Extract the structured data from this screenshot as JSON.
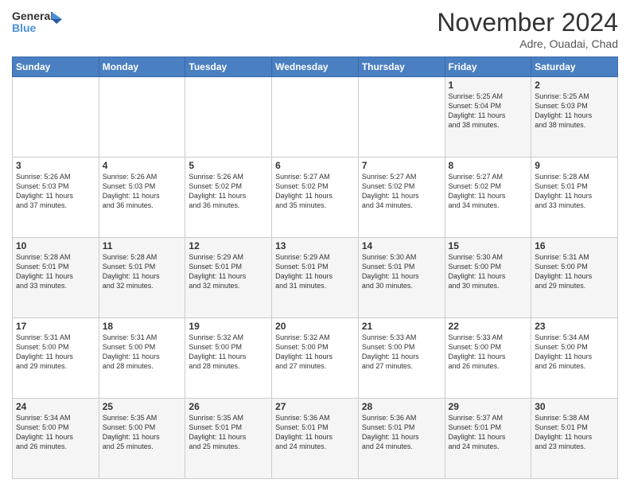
{
  "header": {
    "logo_line1": "General",
    "logo_line2": "Blue",
    "month": "November 2024",
    "location": "Adre, Ouadai, Chad"
  },
  "weekdays": [
    "Sunday",
    "Monday",
    "Tuesday",
    "Wednesday",
    "Thursday",
    "Friday",
    "Saturday"
  ],
  "weeks": [
    [
      {
        "day": "",
        "info": ""
      },
      {
        "day": "",
        "info": ""
      },
      {
        "day": "",
        "info": ""
      },
      {
        "day": "",
        "info": ""
      },
      {
        "day": "",
        "info": ""
      },
      {
        "day": "1",
        "info": "Sunrise: 5:25 AM\nSunset: 5:04 PM\nDaylight: 11 hours\nand 38 minutes."
      },
      {
        "day": "2",
        "info": "Sunrise: 5:25 AM\nSunset: 5:03 PM\nDaylight: 11 hours\nand 38 minutes."
      }
    ],
    [
      {
        "day": "3",
        "info": "Sunrise: 5:26 AM\nSunset: 5:03 PM\nDaylight: 11 hours\nand 37 minutes."
      },
      {
        "day": "4",
        "info": "Sunrise: 5:26 AM\nSunset: 5:03 PM\nDaylight: 11 hours\nand 36 minutes."
      },
      {
        "day": "5",
        "info": "Sunrise: 5:26 AM\nSunset: 5:02 PM\nDaylight: 11 hours\nand 36 minutes."
      },
      {
        "day": "6",
        "info": "Sunrise: 5:27 AM\nSunset: 5:02 PM\nDaylight: 11 hours\nand 35 minutes."
      },
      {
        "day": "7",
        "info": "Sunrise: 5:27 AM\nSunset: 5:02 PM\nDaylight: 11 hours\nand 34 minutes."
      },
      {
        "day": "8",
        "info": "Sunrise: 5:27 AM\nSunset: 5:02 PM\nDaylight: 11 hours\nand 34 minutes."
      },
      {
        "day": "9",
        "info": "Sunrise: 5:28 AM\nSunset: 5:01 PM\nDaylight: 11 hours\nand 33 minutes."
      }
    ],
    [
      {
        "day": "10",
        "info": "Sunrise: 5:28 AM\nSunset: 5:01 PM\nDaylight: 11 hours\nand 33 minutes."
      },
      {
        "day": "11",
        "info": "Sunrise: 5:28 AM\nSunset: 5:01 PM\nDaylight: 11 hours\nand 32 minutes."
      },
      {
        "day": "12",
        "info": "Sunrise: 5:29 AM\nSunset: 5:01 PM\nDaylight: 11 hours\nand 32 minutes."
      },
      {
        "day": "13",
        "info": "Sunrise: 5:29 AM\nSunset: 5:01 PM\nDaylight: 11 hours\nand 31 minutes."
      },
      {
        "day": "14",
        "info": "Sunrise: 5:30 AM\nSunset: 5:01 PM\nDaylight: 11 hours\nand 30 minutes."
      },
      {
        "day": "15",
        "info": "Sunrise: 5:30 AM\nSunset: 5:00 PM\nDaylight: 11 hours\nand 30 minutes."
      },
      {
        "day": "16",
        "info": "Sunrise: 5:31 AM\nSunset: 5:00 PM\nDaylight: 11 hours\nand 29 minutes."
      }
    ],
    [
      {
        "day": "17",
        "info": "Sunrise: 5:31 AM\nSunset: 5:00 PM\nDaylight: 11 hours\nand 29 minutes."
      },
      {
        "day": "18",
        "info": "Sunrise: 5:31 AM\nSunset: 5:00 PM\nDaylight: 11 hours\nand 28 minutes."
      },
      {
        "day": "19",
        "info": "Sunrise: 5:32 AM\nSunset: 5:00 PM\nDaylight: 11 hours\nand 28 minutes."
      },
      {
        "day": "20",
        "info": "Sunrise: 5:32 AM\nSunset: 5:00 PM\nDaylight: 11 hours\nand 27 minutes."
      },
      {
        "day": "21",
        "info": "Sunrise: 5:33 AM\nSunset: 5:00 PM\nDaylight: 11 hours\nand 27 minutes."
      },
      {
        "day": "22",
        "info": "Sunrise: 5:33 AM\nSunset: 5:00 PM\nDaylight: 11 hours\nand 26 minutes."
      },
      {
        "day": "23",
        "info": "Sunrise: 5:34 AM\nSunset: 5:00 PM\nDaylight: 11 hours\nand 26 minutes."
      }
    ],
    [
      {
        "day": "24",
        "info": "Sunrise: 5:34 AM\nSunset: 5:00 PM\nDaylight: 11 hours\nand 26 minutes."
      },
      {
        "day": "25",
        "info": "Sunrise: 5:35 AM\nSunset: 5:00 PM\nDaylight: 11 hours\nand 25 minutes."
      },
      {
        "day": "26",
        "info": "Sunrise: 5:35 AM\nSunset: 5:01 PM\nDaylight: 11 hours\nand 25 minutes."
      },
      {
        "day": "27",
        "info": "Sunrise: 5:36 AM\nSunset: 5:01 PM\nDaylight: 11 hours\nand 24 minutes."
      },
      {
        "day": "28",
        "info": "Sunrise: 5:36 AM\nSunset: 5:01 PM\nDaylight: 11 hours\nand 24 minutes."
      },
      {
        "day": "29",
        "info": "Sunrise: 5:37 AM\nSunset: 5:01 PM\nDaylight: 11 hours\nand 24 minutes."
      },
      {
        "day": "30",
        "info": "Sunrise: 5:38 AM\nSunset: 5:01 PM\nDaylight: 11 hours\nand 23 minutes."
      }
    ]
  ]
}
